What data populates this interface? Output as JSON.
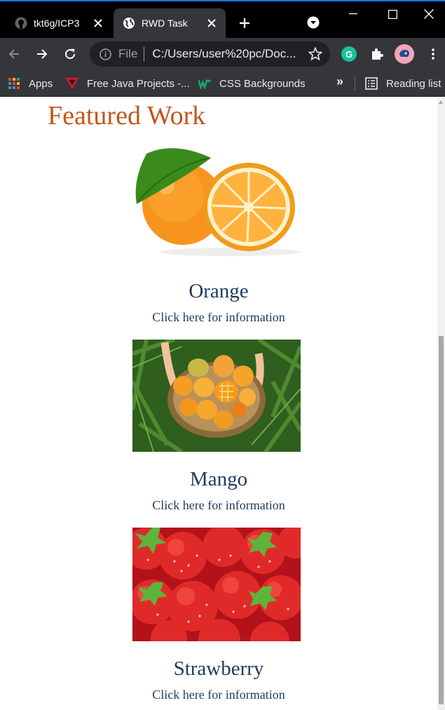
{
  "browser": {
    "tabs": [
      {
        "title": "tkt6g/ICP3",
        "icon": "github-icon",
        "active": false
      },
      {
        "title": "RWD Task",
        "icon": "globe-icon",
        "active": true
      }
    ],
    "address_bar": {
      "scheme": "File",
      "url": "C:/Users/user%20pc/Doc..."
    },
    "bookmarks": [
      {
        "label": "Apps",
        "icon": "apps-grid-icon"
      },
      {
        "label": "Free Java Projects -...",
        "icon": "java-projects-icon"
      },
      {
        "label": "CSS Backgrounds",
        "icon": "css-backgrounds-icon"
      }
    ],
    "bookmarks_overflow": "»",
    "reading_list": "Reading list",
    "colors": {
      "tabstrip": "#000000",
      "toolbar": "#35363a",
      "omnibox": "#202124",
      "accent": "#1a73e8"
    }
  },
  "page": {
    "heading": "Featured Work",
    "heading_color": "#c4551c",
    "text_color": "#1d3c5c",
    "items": [
      {
        "title": "Orange",
        "link": "Click here for information",
        "image": "orange-image"
      },
      {
        "title": "Mango",
        "link": "Click here for information",
        "image": "mango-basket-image"
      },
      {
        "title": "Strawberry",
        "link": "Click here for information",
        "image": "strawberries-image"
      }
    ]
  }
}
